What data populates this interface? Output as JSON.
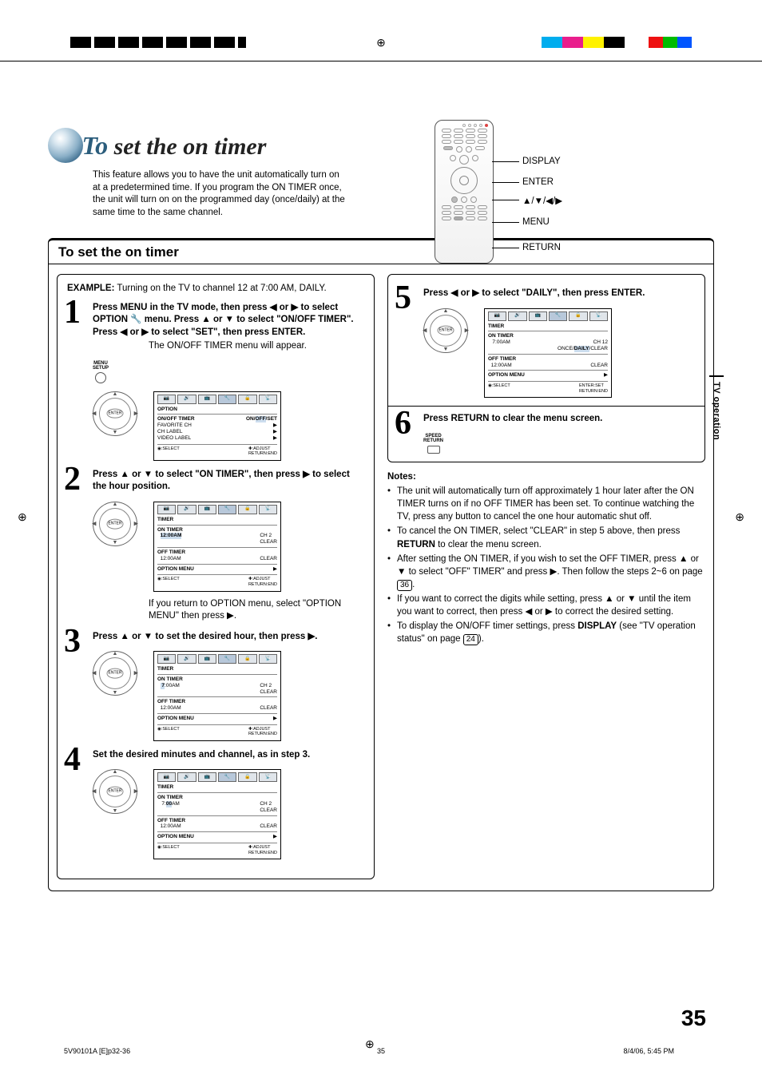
{
  "colors": {
    "accent": "#2b5d7c"
  },
  "top_colorbar": [
    "#00adee",
    "#e91e8c",
    "#fff200",
    "#000000",
    "#e11",
    "#0b0",
    "#05f"
  ],
  "heading": {
    "to": "To",
    "rest": " set the on timer"
  },
  "intro": "This feature allows you to have the unit automatically turn on at a predetermined time. If you program the ON TIMER once, the unit will turn on on the programmed day (once/daily) at the same time to the same channel.",
  "remote_labels": {
    "display": "DISPLAY",
    "enter": "ENTER",
    "arrows": "▲/▼/◀/▶",
    "menu": "MENU",
    "return": "RETURN"
  },
  "section_title": "To set the on timer",
  "example": {
    "label": "EXAMPLE:",
    "text": " Turning on the TV to channel 12 at 7:00 AM, DAILY."
  },
  "steps": {
    "s1": {
      "num": "1",
      "body": "Press MENU in the TV mode, then press ◀ or ▶ to select OPTION 🔧 menu. Press ▲ or ▼ to select \"ON/OFF TIMER\". Press ◀ or ▶ to select \"SET\", then press ENTER.",
      "sub": "The ON/OFF TIMER menu will appear.",
      "menu_label": "MENU\nSETUP"
    },
    "s2": {
      "num": "2",
      "body": "Press ▲ or ▼ to select \"ON TIMER\", then press ▶ to select the hour position.",
      "sub": "If you return to OPTION menu, select \"OPTION MENU\" then press ▶."
    },
    "s3": {
      "num": "3",
      "body": "Press ▲ or ▼ to set the desired hour, then press ▶."
    },
    "s4": {
      "num": "4",
      "body": "Set the desired minutes and channel, as in step 3."
    },
    "s5": {
      "num": "5",
      "body": "Press ◀ or ▶ to select \"DAILY\", then press ENTER."
    },
    "s6": {
      "num": "6",
      "body": "Press RETURN to clear the menu screen.",
      "ret_label": "SPEED\nRETURN"
    }
  },
  "osd": {
    "option_title": "OPTION",
    "option_items": [
      {
        "l": "ON/OFF TIMER",
        "r": "ON/OFF/SET"
      },
      {
        "l": "FAVORITE CH",
        "r": "▶"
      },
      {
        "l": "CH LABEL",
        "r": "▶"
      },
      {
        "l": "VIDEO LABEL",
        "r": "▶"
      }
    ],
    "foot_select": "◉:SELECT",
    "foot_adjust": "✚:ADJUST",
    "foot_return": "RETURN:END",
    "foot_enter": "ENTER:SET",
    "timer_title": "TIMER",
    "on_timer": "ON TIMER",
    "off_timer": "OFF TIMER",
    "option_menu": "OPTION MENU",
    "s2": {
      "on": "12:00AM",
      "ch": "CH    2",
      "clear": "CLEAR",
      "off": "12:00AM",
      "offr": "CLEAR",
      "opt": "▶"
    },
    "s3": {
      "on": "  7:00AM",
      "ch": "CH    2",
      "clear": "CLEAR",
      "off": "12:00AM",
      "offr": "CLEAR",
      "opt": "▶"
    },
    "s4": {
      "on": "  7:00AM",
      "ch": "CH    2",
      "clear": "CLEAR",
      "off": "12:00AM",
      "offr": "CLEAR",
      "opt": "▶"
    },
    "s5": {
      "on": "  7:00AM",
      "ch": "CH   12",
      "mode": "ONCE/DAILY/CLEAR",
      "off": "12:00AM",
      "offr": "CLEAR",
      "opt": "▶"
    }
  },
  "notes": {
    "label": "Notes:",
    "items": [
      "The unit will automatically turn off approximately 1 hour later after the ON TIMER turns on if no OFF TIMER has been set. To continue watching the TV, press any button to cancel the one hour automatic shut off.",
      "To cancel the ON TIMER, select \"CLEAR\" in step 5 above, then press RETURN to clear the menu screen.",
      "After setting the ON TIMER, if you wish to set the OFF TIMER, press ▲ or ▼ to select \"OFF\" TIMER\" and press ▶. Then follow the steps 2~6 on page 36.",
      "If you want to correct the digits while setting, press ▲ or ▼ until the item you want to correct, then press ◀ or ▶ to correct the desired setting.",
      "To display the ON/OFF timer settings, press DISPLAY (see \"TV operation status\" on page 24)."
    ],
    "bold": {
      "return": "RETURN",
      "display": "DISPLAY"
    },
    "page_ref_36": "36",
    "page_ref_24": "24"
  },
  "side_tab": "TV operation",
  "page_number": "35",
  "footer": {
    "left": "5V90101A [E]p32-36",
    "center": "35",
    "right": "8/4/06, 5:45 PM"
  }
}
